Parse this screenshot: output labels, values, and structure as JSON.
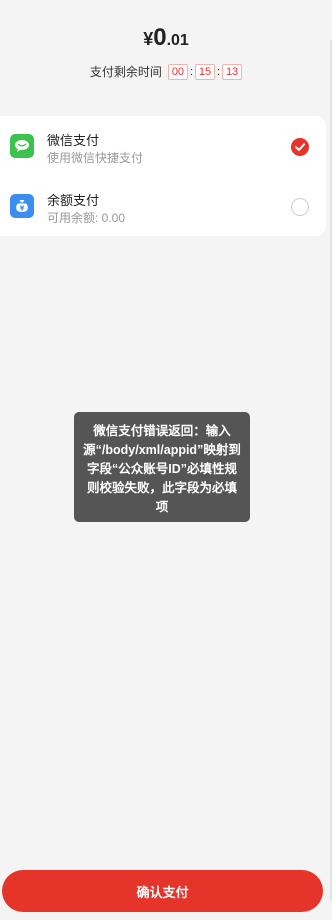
{
  "amount": {
    "currency": "¥",
    "integer": "0",
    "decimal": ".01"
  },
  "timer": {
    "label": "支付剩余时间",
    "hours": "00",
    "minutes": "15",
    "seconds": "13",
    "separator": ":"
  },
  "payment_methods": [
    {
      "title": "微信支付",
      "subtitle": "使用微信快捷支付",
      "icon": "wechat-icon",
      "selected": true,
      "color": "#3cc24f"
    },
    {
      "title": "余额支付",
      "subtitle": "可用余额: 0.00",
      "icon": "wallet-icon",
      "selected": false,
      "color": "#3b8ef0"
    }
  ],
  "toast": {
    "message": "微信支付错误返回：输入源“/body/xml/appid”映射到字段“公众账号ID”必填性规则校验失败，此字段为必填项"
  },
  "confirm_button": {
    "label": "确认支付"
  },
  "colors": {
    "accent": "#e5352a",
    "background": "#f4f4f4"
  }
}
